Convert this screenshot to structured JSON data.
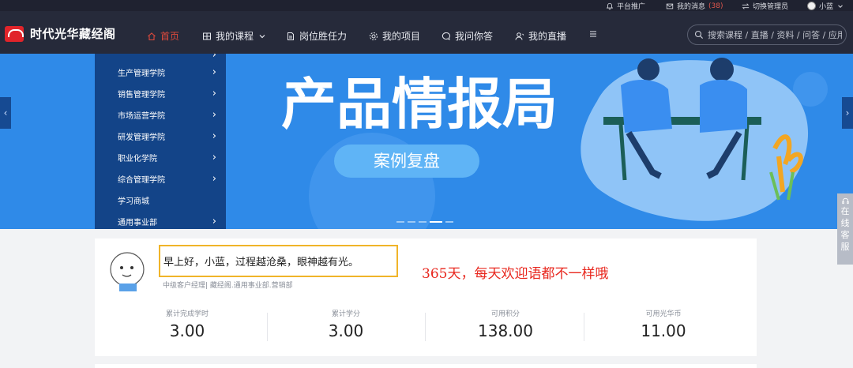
{
  "utilbar": {
    "promote": "平台推广",
    "messages": "我的消息",
    "message_count": "(38)",
    "switch_admin": "切换管理员",
    "user_name": "小蓝"
  },
  "nav": {
    "brand": "时代光华藏经阁",
    "items": [
      {
        "label": "首页",
        "icon": "home-icon"
      },
      {
        "label": "我的课程",
        "icon": "grid-icon"
      },
      {
        "label": "岗位胜任力",
        "icon": "document-icon"
      },
      {
        "label": "我的项目",
        "icon": "gear-icon"
      },
      {
        "label": "我问你答",
        "icon": "chat-icon"
      },
      {
        "label": "我的直播",
        "icon": "live-icon"
      }
    ],
    "search_placeholder": "搜索课程 / 直播 / 资料 / 问答 / 应用"
  },
  "banner": {
    "categories": [
      {
        "label": "生产管理学院"
      },
      {
        "label": "销售管理学院"
      },
      {
        "label": "市场运营学院"
      },
      {
        "label": "研发管理学院"
      },
      {
        "label": "职业化学院"
      },
      {
        "label": "综合管理学院"
      },
      {
        "label": "学习商城"
      },
      {
        "label": "通用事业部"
      }
    ],
    "title": "产品情报局",
    "button": "案例复盘"
  },
  "side_service": [
    "在",
    "线",
    "客",
    "服"
  ],
  "welcome": {
    "greeting": "早上好，小蓝，过程越沧桑，眼神越有光。",
    "annotation": "365天，每天欢迎语都不一样哦",
    "roles": "中级客户经理| 藏经阁.通用事业部.营销部",
    "stats": [
      {
        "label": "累计完成学时",
        "value": "3.00"
      },
      {
        "label": "累计学分",
        "value": "3.00"
      },
      {
        "label": "可用积分",
        "value": "138.00"
      },
      {
        "label": "可用光华币",
        "value": "11.00"
      }
    ]
  },
  "colors": {
    "nav_bg": "#262a3a",
    "accent_red": "#e04a3c",
    "banner_blue": "#2f8ae8",
    "category_bg": "#134488",
    "highlight_border": "#f0b429"
  }
}
